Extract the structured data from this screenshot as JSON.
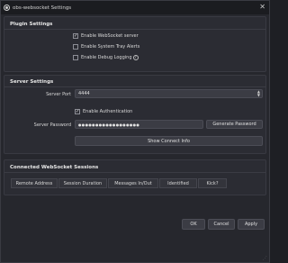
{
  "window": {
    "title": "obs-websocket Settings",
    "close_glyph": "✕"
  },
  "plugin_settings": {
    "heading": "Plugin Settings",
    "checkboxes": [
      {
        "label": "Enable WebSocket server",
        "checked": true
      },
      {
        "label": "Enable System Tray Alerts",
        "checked": false
      },
      {
        "label": "Enable Debug Logging",
        "checked": false
      }
    ]
  },
  "server_settings": {
    "heading": "Server Settings",
    "server_port_label": "Server Port",
    "server_port_value": "4444",
    "enable_auth_label": "Enable Authentication",
    "enable_auth_checked": true,
    "server_password_label": "Server Password",
    "server_password_value": "●●●●●●●●●●●●●●●●●●",
    "generate_password_label": "Generate Password",
    "show_connect_info_label": "Show Connect Info"
  },
  "sessions": {
    "heading": "Connected WebSocket Sessions",
    "columns": [
      "Remote Address",
      "Session Duration",
      "Messages In/Out",
      "Identified",
      "Kick?"
    ]
  },
  "footer": {
    "ok_label": "OK",
    "cancel_label": "Cancel",
    "apply_label": "Apply"
  },
  "colors": {
    "background": "#26272d",
    "panel": "#2b2c33",
    "button": "#3b3c44"
  }
}
